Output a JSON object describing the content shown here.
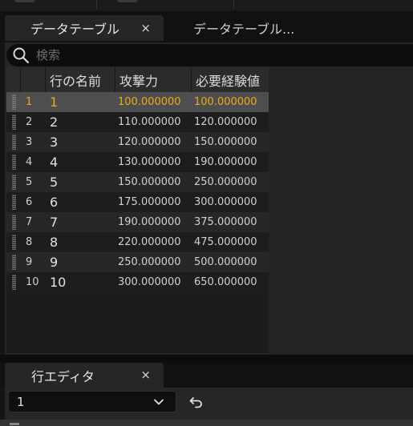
{
  "tabs": [
    {
      "label": "データテーブル",
      "close": "×"
    },
    {
      "label": "データテーブル..."
    }
  ],
  "search": {
    "placeholder": "検索"
  },
  "table": {
    "headers": [
      "行の名前",
      "攻撃力",
      "必要経験値"
    ],
    "rows": [
      {
        "index": "1",
        "name": "1",
        "attack": "100.000000",
        "exp": "100.000000",
        "selected": true
      },
      {
        "index": "2",
        "name": "2",
        "attack": "110.000000",
        "exp": "120.000000"
      },
      {
        "index": "3",
        "name": "3",
        "attack": "120.000000",
        "exp": "150.000000"
      },
      {
        "index": "4",
        "name": "4",
        "attack": "130.000000",
        "exp": "190.000000"
      },
      {
        "index": "5",
        "name": "5",
        "attack": "150.000000",
        "exp": "250.000000"
      },
      {
        "index": "6",
        "name": "6",
        "attack": "175.000000",
        "exp": "300.000000"
      },
      {
        "index": "7",
        "name": "7",
        "attack": "190.000000",
        "exp": "375.000000"
      },
      {
        "index": "8",
        "name": "8",
        "attack": "220.000000",
        "exp": "475.000000"
      },
      {
        "index": "9",
        "name": "9",
        "attack": "250.000000",
        "exp": "500.000000"
      },
      {
        "index": "10",
        "name": "10",
        "attack": "300.000000",
        "exp": "650.000000"
      }
    ]
  },
  "row_editor": {
    "tab_label": "行エディタ",
    "close": "×",
    "selected_row": "1"
  },
  "colors": {
    "selected_text": "#f0a915",
    "panel": "#262626",
    "background": "#151515"
  },
  "icons": {
    "search": "search-icon",
    "dropdown": "chevron-down-icon",
    "reset": "undo-arrow-icon",
    "drag": "drag-handle-icon"
  }
}
